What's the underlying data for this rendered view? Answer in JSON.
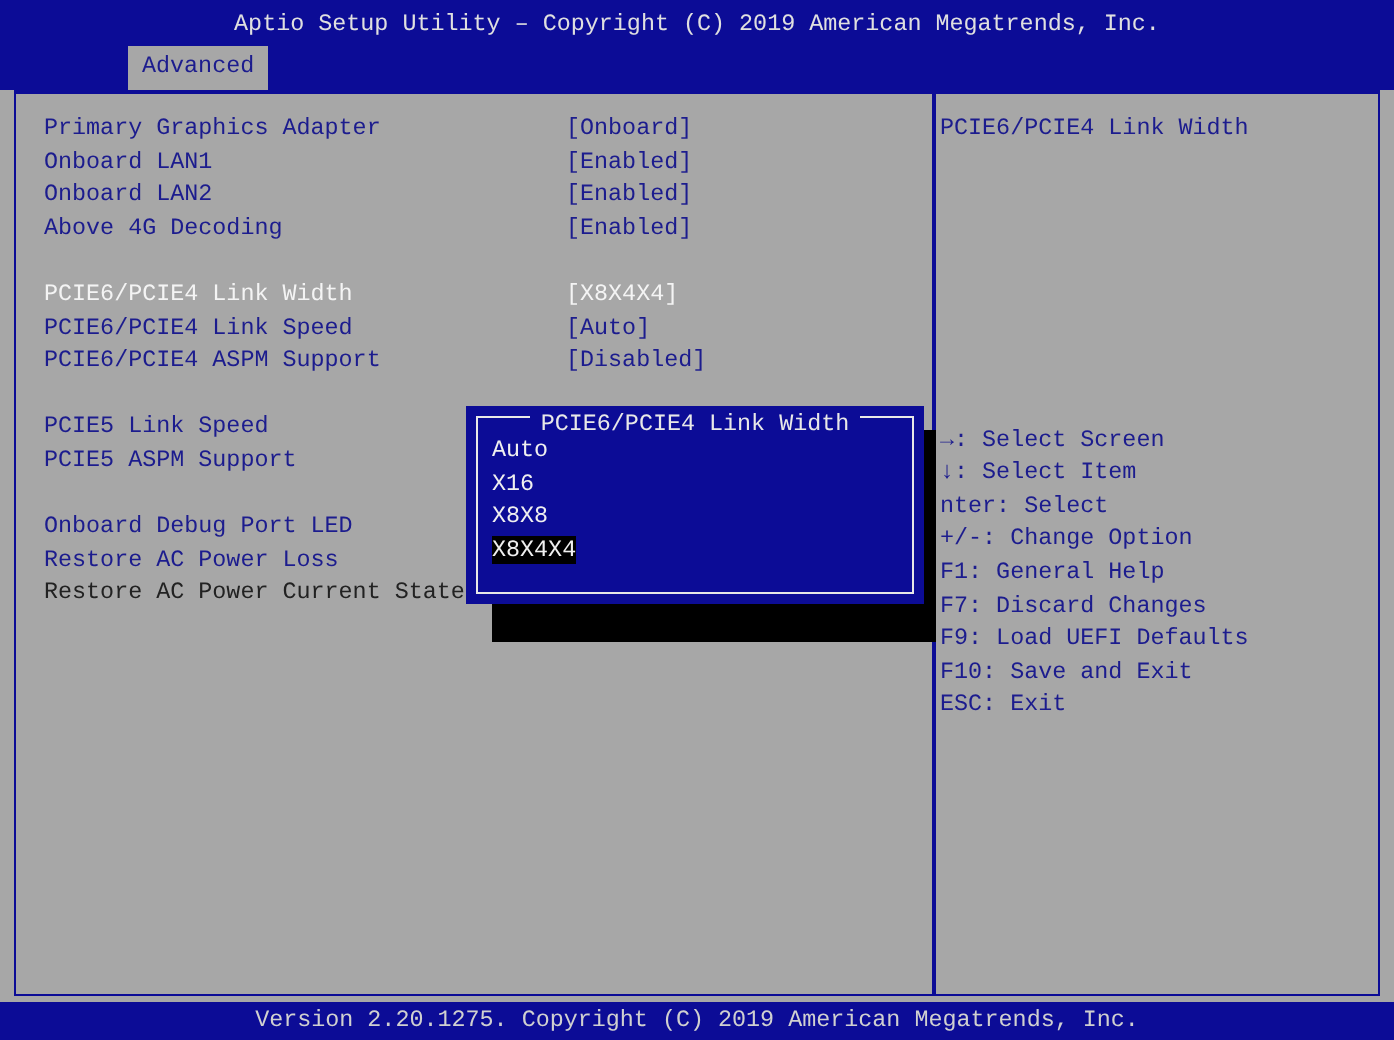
{
  "title": "Aptio Setup Utility – Copyright (C) 2019 American Megatrends, Inc.",
  "tabs": [
    {
      "label": "Advanced",
      "selected": true
    }
  ],
  "settings": [
    [
      {
        "label": "Primary Graphics Adapter",
        "value": "[Onboard]",
        "selected": false
      },
      {
        "label": "Onboard LAN1",
        "value": "[Enabled]",
        "selected": false
      },
      {
        "label": "Onboard LAN2",
        "value": "[Enabled]",
        "selected": false
      },
      {
        "label": "Above 4G Decoding",
        "value": "[Enabled]",
        "selected": false
      }
    ],
    [
      {
        "label": "PCIE6/PCIE4 Link Width",
        "value": "[X8X4X4]",
        "selected": true
      },
      {
        "label": "PCIE6/PCIE4 Link Speed",
        "value": "[Auto]",
        "selected": false
      },
      {
        "label": "PCIE6/PCIE4 ASPM Support",
        "value": "[Disabled]",
        "selected": false
      }
    ],
    [
      {
        "label": "PCIE5 Link Speed",
        "selected": false
      },
      {
        "label": "PCIE5 ASPM Support",
        "selected": false
      }
    ],
    [
      {
        "label": "Onboard Debug Port LED",
        "selected": false
      },
      {
        "label": "Restore AC Power Loss",
        "selected": false
      },
      {
        "label": "Restore AC Power Current State",
        "kind": "info",
        "selected": false
      }
    ]
  ],
  "help_text": "PCIE6/PCIE4 Link Width",
  "key_help": [
    "→: Select Screen",
    "↓: Select Item",
    "nter: Select",
    "+/-: Change Option",
    "F1: General Help",
    "F7: Discard Changes",
    "F9: Load UEFI Defaults",
    "F10: Save and Exit",
    "ESC: Exit"
  ],
  "popup": {
    "title": "PCIE6/PCIE4 Link Width",
    "options": [
      {
        "label": "Auto",
        "selected": false
      },
      {
        "label": "X16",
        "selected": false
      },
      {
        "label": "X8X8",
        "selected": false
      },
      {
        "label": "X8X4X4",
        "selected": true
      }
    ]
  },
  "footer": "Version 2.20.1275. Copyright (C) 2019 American Megatrends, Inc."
}
